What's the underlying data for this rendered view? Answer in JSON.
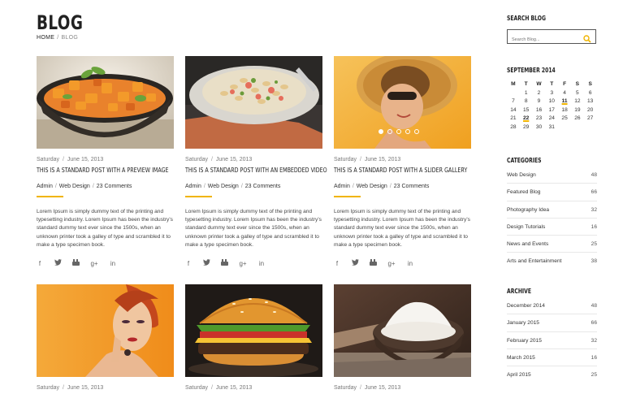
{
  "page": {
    "title": "BLOG"
  },
  "breadcrumb": {
    "home": "HOME",
    "current": "BLOG"
  },
  "posts": [
    {
      "date": "Saturday",
      "date2": "June 15, 2013",
      "title": "THIS IS A STANDARD POST WITH A PREVIEW IMAGE",
      "author": "Admin",
      "category": "Web Design",
      "comments": "23 Comments",
      "excerpt": "Lorem Ipsum is simply dummy text of the printing and typesetting industry. Lorem Ipsum has been the industry's standard dummy text ever since the 1500s, when an unknown printer took a galley of type and scrambled it to make a type specimen book."
    },
    {
      "date": "Saturday",
      "date2": "June 15, 2013",
      "title": "THIS IS A STANDARD POST WITH AN EMBEDDED VIDEO",
      "author": "Admin",
      "category": "Web Design",
      "comments": "23 Comments",
      "excerpt": "Lorem Ipsum is simply dummy text of the printing and typesetting industry. Lorem Ipsum has been the industry's standard dummy text ever since the 1500s, when an unknown printer took a galley of type and scrambled it to make a type specimen book."
    },
    {
      "date": "Saturday",
      "date2": "June 15, 2013",
      "title": "THIS IS A STANDARD POST WITH A SLIDER GALLERY",
      "author": "Admin",
      "category": "Web Design",
      "comments": "23 Comments",
      "excerpt": "Lorem Ipsum is simply dummy text of the printing and typesetting industry. Lorem Ipsum has been the industry's standard dummy text ever since the 1500s, when an unknown printer took a galley of type and scrambled it to make a type specimen book."
    },
    {
      "date": "Saturday",
      "date2": "June 15, 2013"
    },
    {
      "date": "Saturday",
      "date2": "June 15, 2013"
    },
    {
      "date": "Saturday",
      "date2": "June 15, 2013"
    }
  ],
  "social_icons": [
    "facebook-icon",
    "twitter-icon",
    "youtube-icon",
    "google-plus-icon",
    "linkedin-icon"
  ],
  "sidebar": {
    "search_title": "SEARCH BLOG",
    "search_placeholder": "Search Blog...",
    "calendar_title": "SEPTEMBER 2014",
    "calendar_days": [
      "M",
      "T",
      "W",
      "T",
      "F",
      "S",
      "S"
    ],
    "calendar_weeks": [
      [
        "",
        "1",
        "2",
        "3",
        "4",
        "5",
        "6"
      ],
      [
        "7",
        "8",
        "9",
        "10",
        "11",
        "12",
        "13"
      ],
      [
        "14",
        "15",
        "16",
        "17",
        "18",
        "19",
        "20"
      ],
      [
        "21",
        "22",
        "23",
        "24",
        "25",
        "26",
        "27"
      ],
      [
        "28",
        "29",
        "30",
        "31",
        "",
        "",
        ""
      ]
    ],
    "categories_title": "CATEGORIES",
    "categories": [
      {
        "label": "Web Design",
        "count": "48"
      },
      {
        "label": "Featured Blog",
        "count": "66"
      },
      {
        "label": "Photography Idea",
        "count": "32"
      },
      {
        "label": "Design Tutorials",
        "count": "16"
      },
      {
        "label": "News and Events",
        "count": "25"
      },
      {
        "label": "Arts and Entertainment",
        "count": "38"
      }
    ],
    "archive_title": "ARCHIVE",
    "archive": [
      {
        "label": "December 2014",
        "count": "48"
      },
      {
        "label": "January 2015",
        "count": "66"
      },
      {
        "label": "February 2015",
        "count": "32"
      },
      {
        "label": "March 2015",
        "count": "16"
      },
      {
        "label": "April 2015",
        "count": "25"
      }
    ]
  },
  "colors": {
    "accent": "#f0b400"
  }
}
